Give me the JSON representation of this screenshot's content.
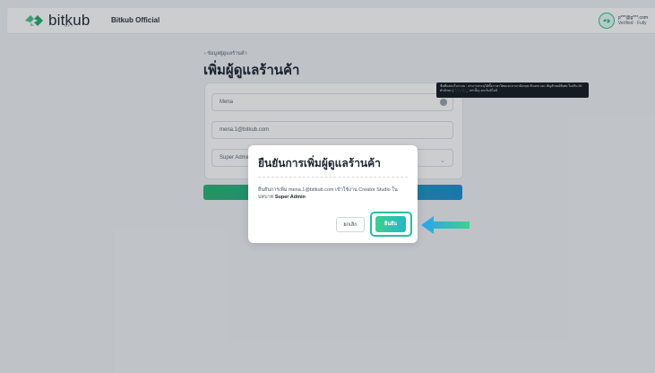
{
  "app": {
    "logo_text": "bitkub",
    "logo_sub": "NFT",
    "shop_name": "Bitkub Official",
    "account_email": "p***@g***.com",
    "account_role": "Verified · Fully"
  },
  "page": {
    "back_label": "ข้อมูลผู้ดูแลร้านค้า",
    "title": "เพิ่มผู้ดูแลร้านค้า"
  },
  "form": {
    "name_value": "Mena",
    "email_value": "mena.1@bitkub.com",
    "role_value": "Super Admin"
  },
  "tooltip": {
    "text": "ชื่อที่แสดงในระบบ : สามารถระบุได้ทั้งภาษาไทยและภาษาอังกฤษ ตัวเลข และ สัญลักษณ์พิเศษ ไม่เกิน 50 ตัวอักษร (' ', '.', '-', '_' เท่านั้น) ยกเว้นอิโมจิ"
  },
  "dialog": {
    "title": "ยืนยันการเพิ่มผู้ดูแลร้านค้า",
    "body_prefix": "ยืนยันการเพิ่ม",
    "body_email": "mena.1@bitkub.com",
    "body_middle": "เข้าใช้งาน Creator Studio ในบทบาท",
    "body_role": "Super Admin",
    "cancel_label": "ยกเลิก",
    "confirm_label": "ยืนยัน"
  },
  "colors": {
    "accent_green": "#2bb673",
    "accent_blue": "#1e8fd6",
    "arrow_blue": "#3aa0e8"
  }
}
